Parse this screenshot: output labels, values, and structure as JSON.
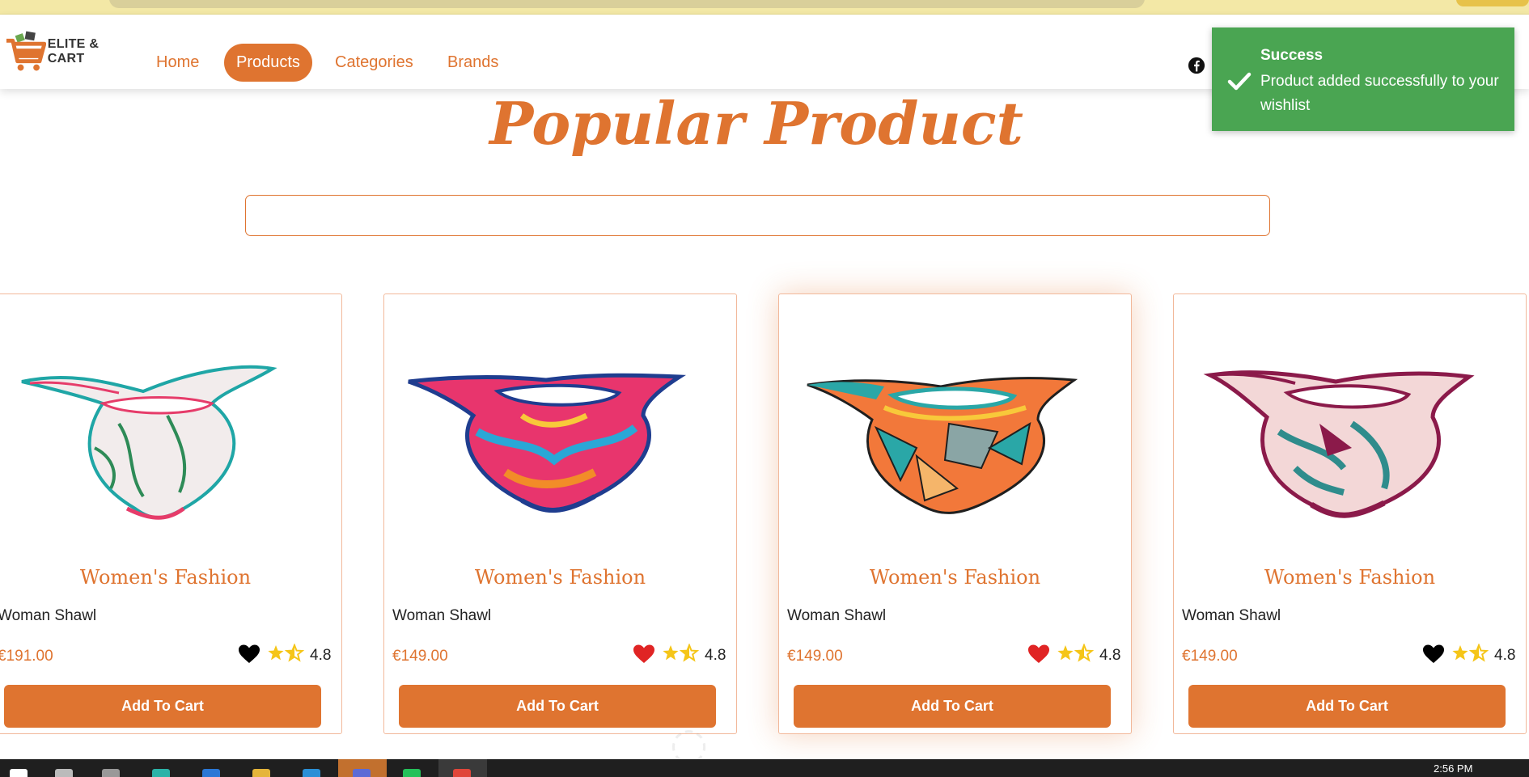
{
  "brand": {
    "name": "ELITE & CART"
  },
  "nav": {
    "home": "Home",
    "products": "Products",
    "categories": "Categories",
    "brands": "Brands"
  },
  "social": {
    "icon": "facebook-icon"
  },
  "toast": {
    "title": "Success",
    "message": "Product added successfully to your wishlist",
    "color": "#4aa552"
  },
  "page_title": "Popular Product",
  "search": {
    "value": "",
    "placeholder": ""
  },
  "products": [
    {
      "category": "Women's Fashion",
      "title": "Woman Shawl",
      "price": "€191.00",
      "rating": "4.8",
      "wishlisted": false,
      "button": "Add To Cart"
    },
    {
      "category": "Women's Fashion",
      "title": "Woman Shawl",
      "price": "€149.00",
      "rating": "4.8",
      "wishlisted": true,
      "button": "Add To Cart"
    },
    {
      "category": "Women's Fashion",
      "title": "Woman Shawl",
      "price": "€149.00",
      "rating": "4.8",
      "wishlisted": true,
      "button": "Add To Cart"
    },
    {
      "category": "Women's Fashion",
      "title": "Woman Shawl",
      "price": "€149.00",
      "rating": "4.8",
      "wishlisted": false,
      "button": "Add To Cart"
    }
  ],
  "taskbar": {
    "time": "2:56 PM"
  },
  "colors": {
    "accent": "#df7430",
    "heart_active": "#e02424",
    "heart_inactive": "#000000",
    "star": "#f5c518"
  }
}
